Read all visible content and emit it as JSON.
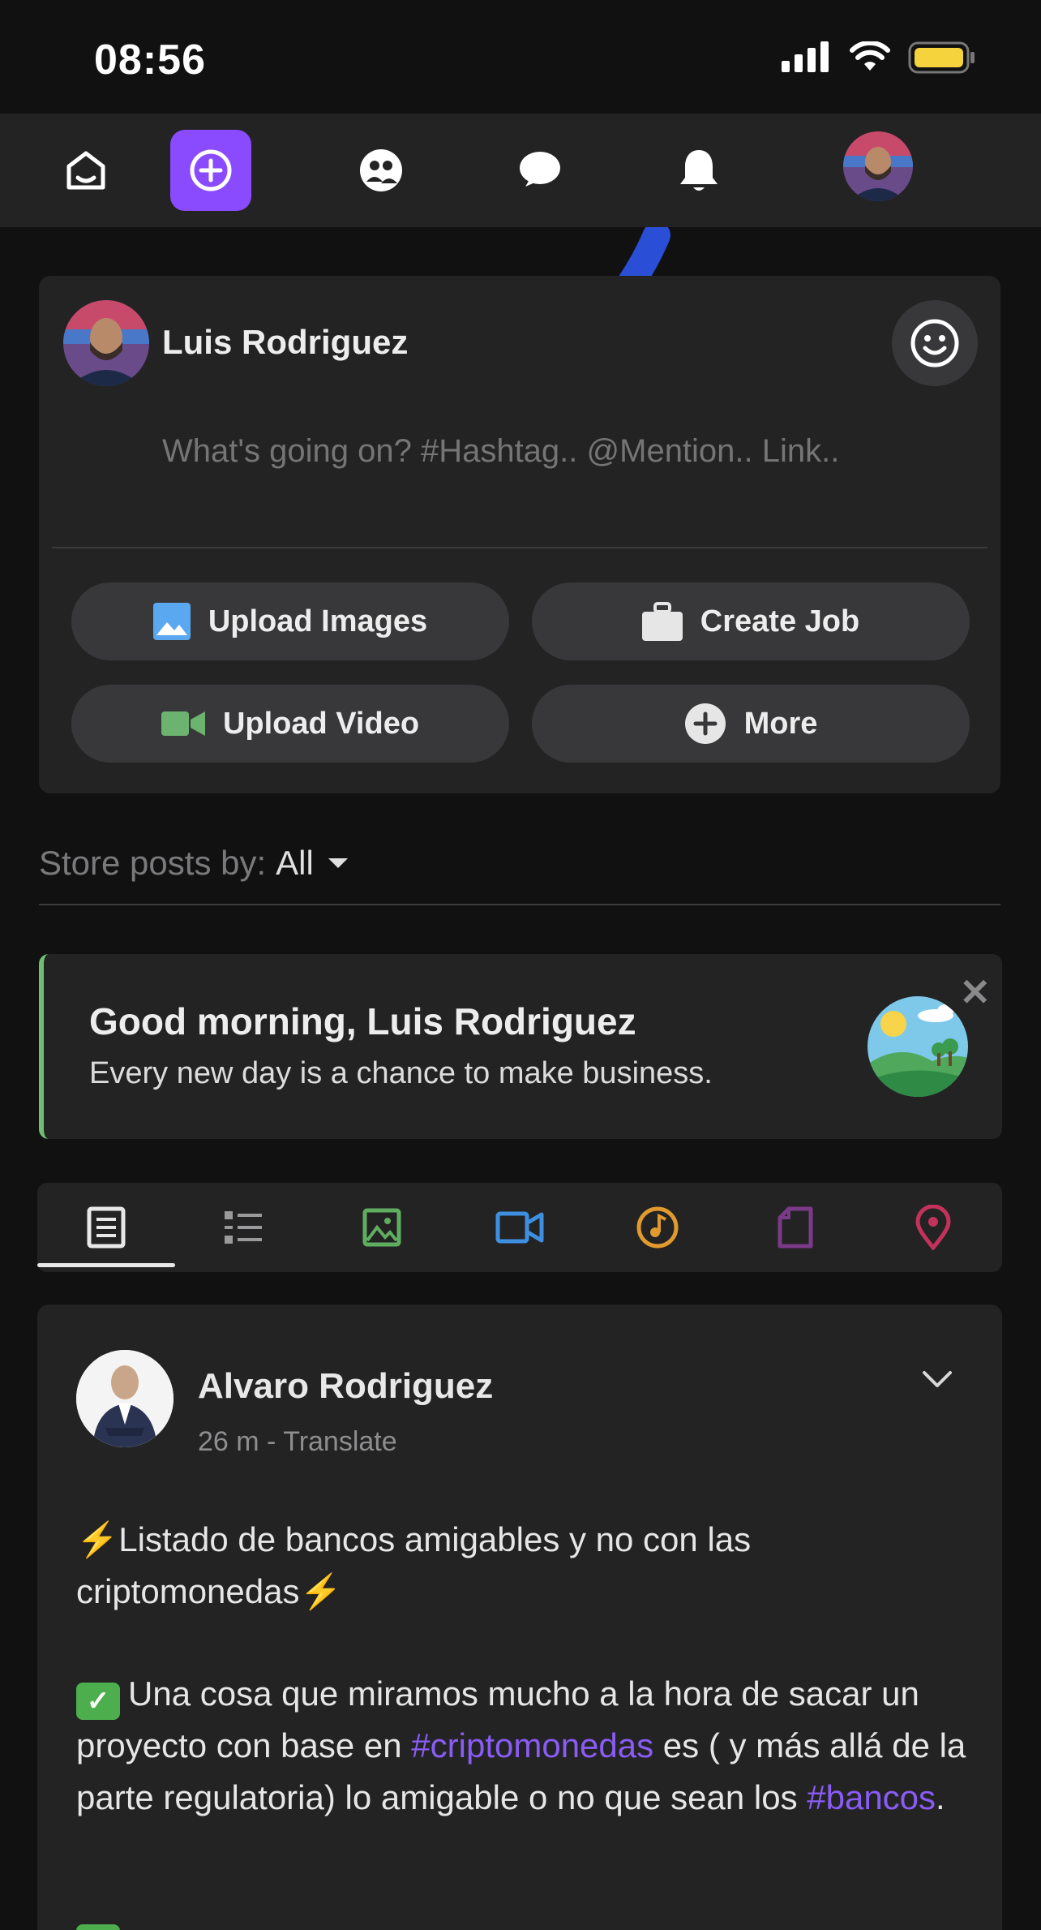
{
  "status_bar": {
    "time": "08:56"
  },
  "nav": {
    "items": [
      "home-icon",
      "create-post-icon",
      "groups-icon",
      "messages-icon",
      "notifications-icon",
      "profile-avatar"
    ],
    "accent": "#8a4bff"
  },
  "composer": {
    "user_name": "Luis Rodriguez",
    "placeholder": "What's going on? #Hashtag.. @Mention.. Link..",
    "buttons": {
      "upload_images": "Upload Images",
      "create_job": "Create Job",
      "upload_video": "Upload Video",
      "more": "More"
    }
  },
  "sort": {
    "label": "Store posts by:",
    "value": "All"
  },
  "greeting": {
    "title": "Good morning, Luis Rodriguez",
    "subtitle": "Every new day is a chance to make business.",
    "accent": "#6fbf73"
  },
  "filters": {
    "tabs": [
      "all-posts-icon",
      "list-icon",
      "photos-icon",
      "videos-icon",
      "music-icon",
      "files-icon",
      "location-icon"
    ],
    "active_index": 0
  },
  "post": {
    "author": "Alvaro Rodriguez",
    "meta": "26 m - Translate",
    "line1_text": "Listado de bancos amigables y no con las criptomonedas",
    "p2_before": "Una cosa que miramos mucho a la hora de sacar un proyecto con base en ",
    "hashtag1": "#criptomonedas",
    "p2_middle": " es ( y más allá de la parte regulatoria) lo amigable o no que sean los ",
    "hashtag2": "#bancos",
    "p2_after": ".",
    "hashtag_color": "#8a5cf6"
  }
}
